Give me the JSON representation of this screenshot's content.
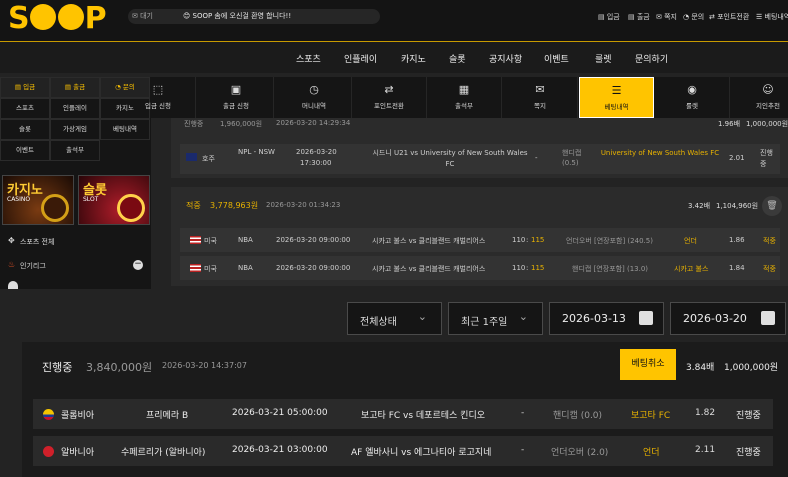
{
  "brand": {
    "logo": "SOOP"
  },
  "notice": {
    "mail_label": "✉ 대기",
    "text": "😊 SOOP 솜에 오신걸 환영 합니다!!"
  },
  "user_menu": [
    "입금",
    "출금",
    "쪽지",
    "문의",
    "포인트전환",
    "베팅내역"
  ],
  "nav": [
    "스포츠",
    "인플레이",
    "카지노",
    "슬롯",
    "공지사항",
    "이벤트",
    "룰렛",
    "문의하기"
  ],
  "quick_grid": [
    {
      "label": "입금",
      "highlight": true
    },
    {
      "label": "출금",
      "highlight": true
    },
    {
      "label": "문의",
      "highlight": true
    },
    {
      "label": "스포츠"
    },
    {
      "label": "인플레이"
    },
    {
      "label": "카지노"
    },
    {
      "label": "슬롯"
    },
    {
      "label": "가상게임"
    },
    {
      "label": "베팅내역"
    },
    {
      "label": "이벤트"
    },
    {
      "label": "출석부"
    }
  ],
  "banners": {
    "casino_title": "카지노",
    "casino_sub": "CASINO",
    "slot_title": "슬롯",
    "slot_sub": "SLOT"
  },
  "side_menu": {
    "sports_all": "스포츠 전체",
    "popular": "인기리그"
  },
  "icon_bar": [
    {
      "label": "입금 신청",
      "icon": "deposit-icon",
      "glyph": "⬚"
    },
    {
      "label": "출금 신청",
      "icon": "withdraw-icon",
      "glyph": "▣"
    },
    {
      "label": "머니내역",
      "icon": "clock-icon",
      "glyph": "◷"
    },
    {
      "label": "포인트전환",
      "icon": "exchange-icon",
      "glyph": "⇄"
    },
    {
      "label": "출석부",
      "icon": "calendar-icon",
      "glyph": "▦"
    },
    {
      "label": "쪽지",
      "icon": "mail-icon",
      "glyph": "✉"
    },
    {
      "label": "베팅내역",
      "icon": "list-icon",
      "glyph": "☰",
      "active": true
    },
    {
      "label": "룰렛",
      "icon": "roulette-icon",
      "glyph": "◉"
    },
    {
      "label": "지인추천",
      "icon": "user-icon",
      "glyph": "☺"
    }
  ],
  "history": {
    "first": {
      "status": "진행중",
      "amount": "1,960,000원",
      "time": "2026-03-20 14:29:34",
      "odds": "1.96배",
      "payout": "1,000,000원",
      "row": {
        "country": "호주",
        "league": "NPL - NSW",
        "date": "2026-03-20",
        "time": "17:30:00",
        "match": "시드니 U21 vs University of New South Wales FC",
        "score": "-",
        "bet_type": "핸디캡",
        "bet_type2": "(0.5)",
        "pick": "University of New South Wales FC",
        "rate": "2.01",
        "status": "진행중"
      }
    },
    "second": {
      "status": "적중",
      "amount": "3,778,963원",
      "time": "2026-03-20 01:34:23",
      "odds": "3.42배",
      "payout": "1,104,960원",
      "rows": [
        {
          "country": "미국",
          "league": "NBA",
          "datetime": "2026-03-20 09:00:00",
          "match": "시카고 불스 vs 클리블랜드 캐벌리어스",
          "score_a": "110",
          "score_b": "115",
          "bet_type": "언더오버 [연장포함] (240.5)",
          "pick": "언더",
          "rate": "1.86",
          "status": "적중"
        },
        {
          "country": "미국",
          "league": "NBA",
          "datetime": "2026-03-20 09:00:00",
          "match": "시카고 불스 vs 클리블랜드 캐벌리어스",
          "score_a": "110",
          "score_b": "115",
          "bet_type": "핸디캡 [연장포함] (13.0)",
          "pick": "시카고 불스",
          "rate": "1.84",
          "status": "적중"
        }
      ]
    }
  },
  "filters": {
    "status": "전체상태",
    "period": "최근 1주일",
    "from": "2026-03-13",
    "to": "2026-03-20"
  },
  "main_bet": {
    "status": "진행중",
    "amount": "3,840,000원",
    "time": "2026-03-20 14:37:07",
    "cancel": "베팅취소",
    "odds": "3.84배",
    "payout": "1,000,000원",
    "rows": [
      {
        "country": "콜롬비아",
        "league": "프리메라 B",
        "datetime": "2026-03-21 05:00:00",
        "match": "보고타 FC vs 데포르테스 킨디오",
        "score": "-",
        "bet_type": "핸디캡 (0.0)",
        "pick": "보고타 FC",
        "rate": "1.82",
        "status": "진행중"
      },
      {
        "country": "알바니아",
        "league": "수페르리가 (알바니아)",
        "datetime": "2026-03-21 03:00:00",
        "match": "AF 엘바사니 vs 에그나티아 로고지네",
        "score": "-",
        "bet_type": "언더오버 (2.0)",
        "pick": "언더",
        "rate": "2.11",
        "status": "진행중"
      }
    ]
  }
}
